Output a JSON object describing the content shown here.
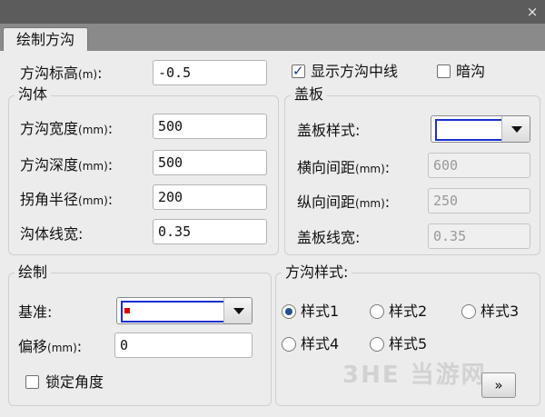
{
  "window": {
    "close_glyph": "×"
  },
  "tab": {
    "label": "绘制方沟"
  },
  "top": {
    "elevation_label": "方沟标高",
    "elevation_unit": "(m)",
    "elevation_colon": ":",
    "elevation_value": "-0.5",
    "show_center_line_label": "显示方沟中线",
    "show_center_line_checked": true,
    "hidden_ditch_label": "暗沟",
    "hidden_ditch_checked": false
  },
  "body_group": {
    "title": "沟体",
    "width_label": "方沟宽度",
    "width_unit": "(mm)",
    "width_value": "500",
    "depth_label": "方沟深度",
    "depth_unit": "(mm)",
    "depth_value": "500",
    "radius_label": "拐角半径",
    "radius_unit": "(mm)",
    "radius_value": "200",
    "line_width_label": "沟体线宽:",
    "line_width_value": "0.35",
    "colon": ":"
  },
  "cover_group": {
    "title": "盖板",
    "style_label": "盖板样式:",
    "h_spacing_label": "横向间距",
    "h_spacing_unit": "(mm)",
    "h_spacing_value": "600",
    "v_spacing_label": "纵向间距",
    "v_spacing_unit": "(mm)",
    "v_spacing_value": "250",
    "line_width_label": "盖板线宽:",
    "line_width_value": "0.35",
    "colon": ":"
  },
  "draw_group": {
    "title": "绘制",
    "base_label": "基准:",
    "offset_label": "偏移",
    "offset_unit": "(mm)",
    "offset_colon": ":",
    "offset_value": "0",
    "lock_angle_label": "锁定角度",
    "lock_angle_checked": false
  },
  "style_group": {
    "title": "方沟样式:",
    "options": [
      "样式1",
      "样式2",
      "样式3",
      "样式4",
      "样式5"
    ],
    "selected": "样式1"
  },
  "more_button": {
    "label": "»"
  },
  "watermark": {
    "text": "3HE 当游网"
  },
  "colors": {
    "accent": "#1a2fd0",
    "marker": "#e00000",
    "titlebar": "#5c5c5c",
    "tabstrip": "#8a8a8a"
  }
}
